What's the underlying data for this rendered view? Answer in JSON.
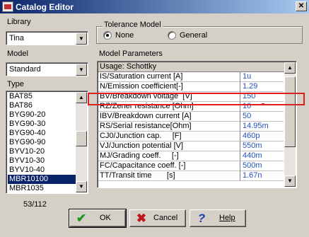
{
  "window": {
    "title": "Catalog Editor",
    "close_glyph": "✕"
  },
  "library": {
    "label": "Library",
    "value": "Tina"
  },
  "model": {
    "label": "Model",
    "value": "Standard"
  },
  "type": {
    "label": "Type",
    "items": [
      "BAT85",
      "BAT86",
      "BYG90-20",
      "BYG90-30",
      "BYG90-40",
      "BYG90-90",
      "BYV10-20",
      "BYV10-30",
      "BYV10-40",
      "MBR10100",
      "MBR1035"
    ],
    "selected": "MBR10100",
    "counter": "53/112"
  },
  "tolerance": {
    "title": "Tolerance Model",
    "options": [
      {
        "label": "None",
        "checked": true
      },
      {
        "label": "General",
        "checked": false
      }
    ]
  },
  "params": {
    "title": "Model Parameters",
    "usage": "Usage: Schottky",
    "rows": [
      {
        "name": "IS/Saturation current [A]",
        "value": "1u"
      },
      {
        "name": "N/Emission coefficient[-]",
        "value": "1.29"
      },
      {
        "name": "BV/Breakdown voltage  [V]",
        "value": "150"
      },
      {
        "name": "RZ/Zener resistance [Ohm]",
        "value": "10"
      },
      {
        "name": "IBV/Breakdown current [A]",
        "value": "50"
      },
      {
        "name": "RS/Serial resistance[Ohm]",
        "value": "14.95m"
      },
      {
        "name": "CJ0/Junction cap.     [F]",
        "value": "460p"
      },
      {
        "name": "VJ/Junction potential [V]",
        "value": "550m"
      },
      {
        "name": "MJ/Grading coeff.     [-]",
        "value": "440m"
      },
      {
        "name": "FC/Capacitance coeff. [-]",
        "value": "500m"
      },
      {
        "name": "TT/Transit time       [s]",
        "value": "1.67n"
      }
    ]
  },
  "buttons": {
    "ok": {
      "label": "OK",
      "icon": "check-icon",
      "color": "#1a9a1a"
    },
    "cancel": {
      "label": "Cancel",
      "icon": "cross-icon",
      "color": "#c01818"
    },
    "help": {
      "label": "Help",
      "icon": "question-icon",
      "color": "#1a3ab0"
    }
  },
  "colors": {
    "highlight": "#e02020",
    "selection": "#0a246a",
    "value_text": "#2050c0"
  }
}
